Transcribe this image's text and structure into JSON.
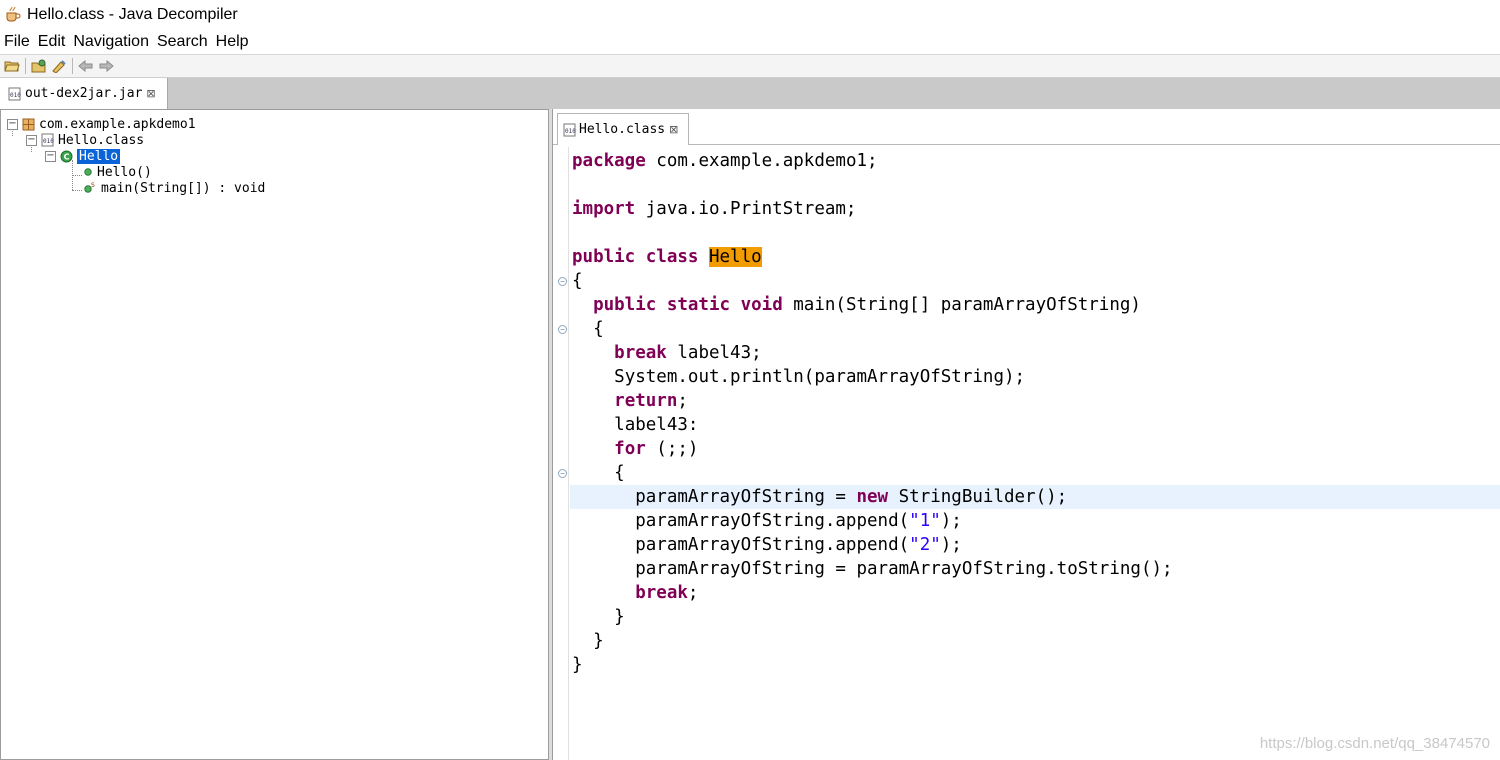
{
  "window": {
    "title": "Hello.class - Java Decompiler"
  },
  "menu": [
    "File",
    "Edit",
    "Navigation",
    "Search",
    "Help"
  ],
  "toolbar": {
    "icons": [
      "open-file-icon",
      "open-type-icon",
      "open-type-hierarchy-icon",
      "back-icon",
      "forward-icon"
    ]
  },
  "main_tab": {
    "label": "out-dex2jar.jar",
    "close": "⊠"
  },
  "tree": {
    "package": "com.example.apkdemo1",
    "class_file": "Hello.class",
    "class": "Hello",
    "members": [
      "Hello()",
      "main(String[]) : void"
    ]
  },
  "editor_tab": {
    "label": "Hello.class",
    "close": "⊠"
  },
  "code": {
    "l1_kw": "package",
    "l1_rest": " com.example.apkdemo1;",
    "l2_kw": "import",
    "l2_rest": " java.io.PrintStream;",
    "l3_kw": "public class",
    "l3_mark": "Hello",
    "l4": "{",
    "l5_kw": "public static void",
    "l5_rest": " main(String[] paramArrayOfString)",
    "l6": "{",
    "l7_kw": "break",
    "l7_rest": " label43;",
    "l8": "System.out.println(paramArrayOfString);",
    "l9_kw": "return",
    "l9_rest": ";",
    "l10": "label43:",
    "l11_kw": "for",
    "l11_rest": " (;;)",
    "l12": "{",
    "l13_pre": "paramArrayOfString = ",
    "l13_kw": "new",
    "l13_rest": " StringBuilder();",
    "l14_pre": "paramArrayOfString.append(",
    "l14_str": "\"1\"",
    "l14_post": ");",
    "l15_pre": "paramArrayOfString.append(",
    "l15_str": "\"2\"",
    "l15_post": ");",
    "l16": "paramArrayOfString = paramArrayOfString.toString();",
    "l17_kw": "break",
    "l17_rest": ";",
    "l18": "}",
    "l19": "}",
    "l20": "}"
  },
  "watermark": "https://blog.csdn.net/qq_38474570",
  "colors": {
    "keyword": "#7f0055",
    "string": "#2a00ff",
    "selection": "#0a64d8",
    "highlight_line": "#e8f2fe",
    "occurrence": "#f39c00"
  }
}
